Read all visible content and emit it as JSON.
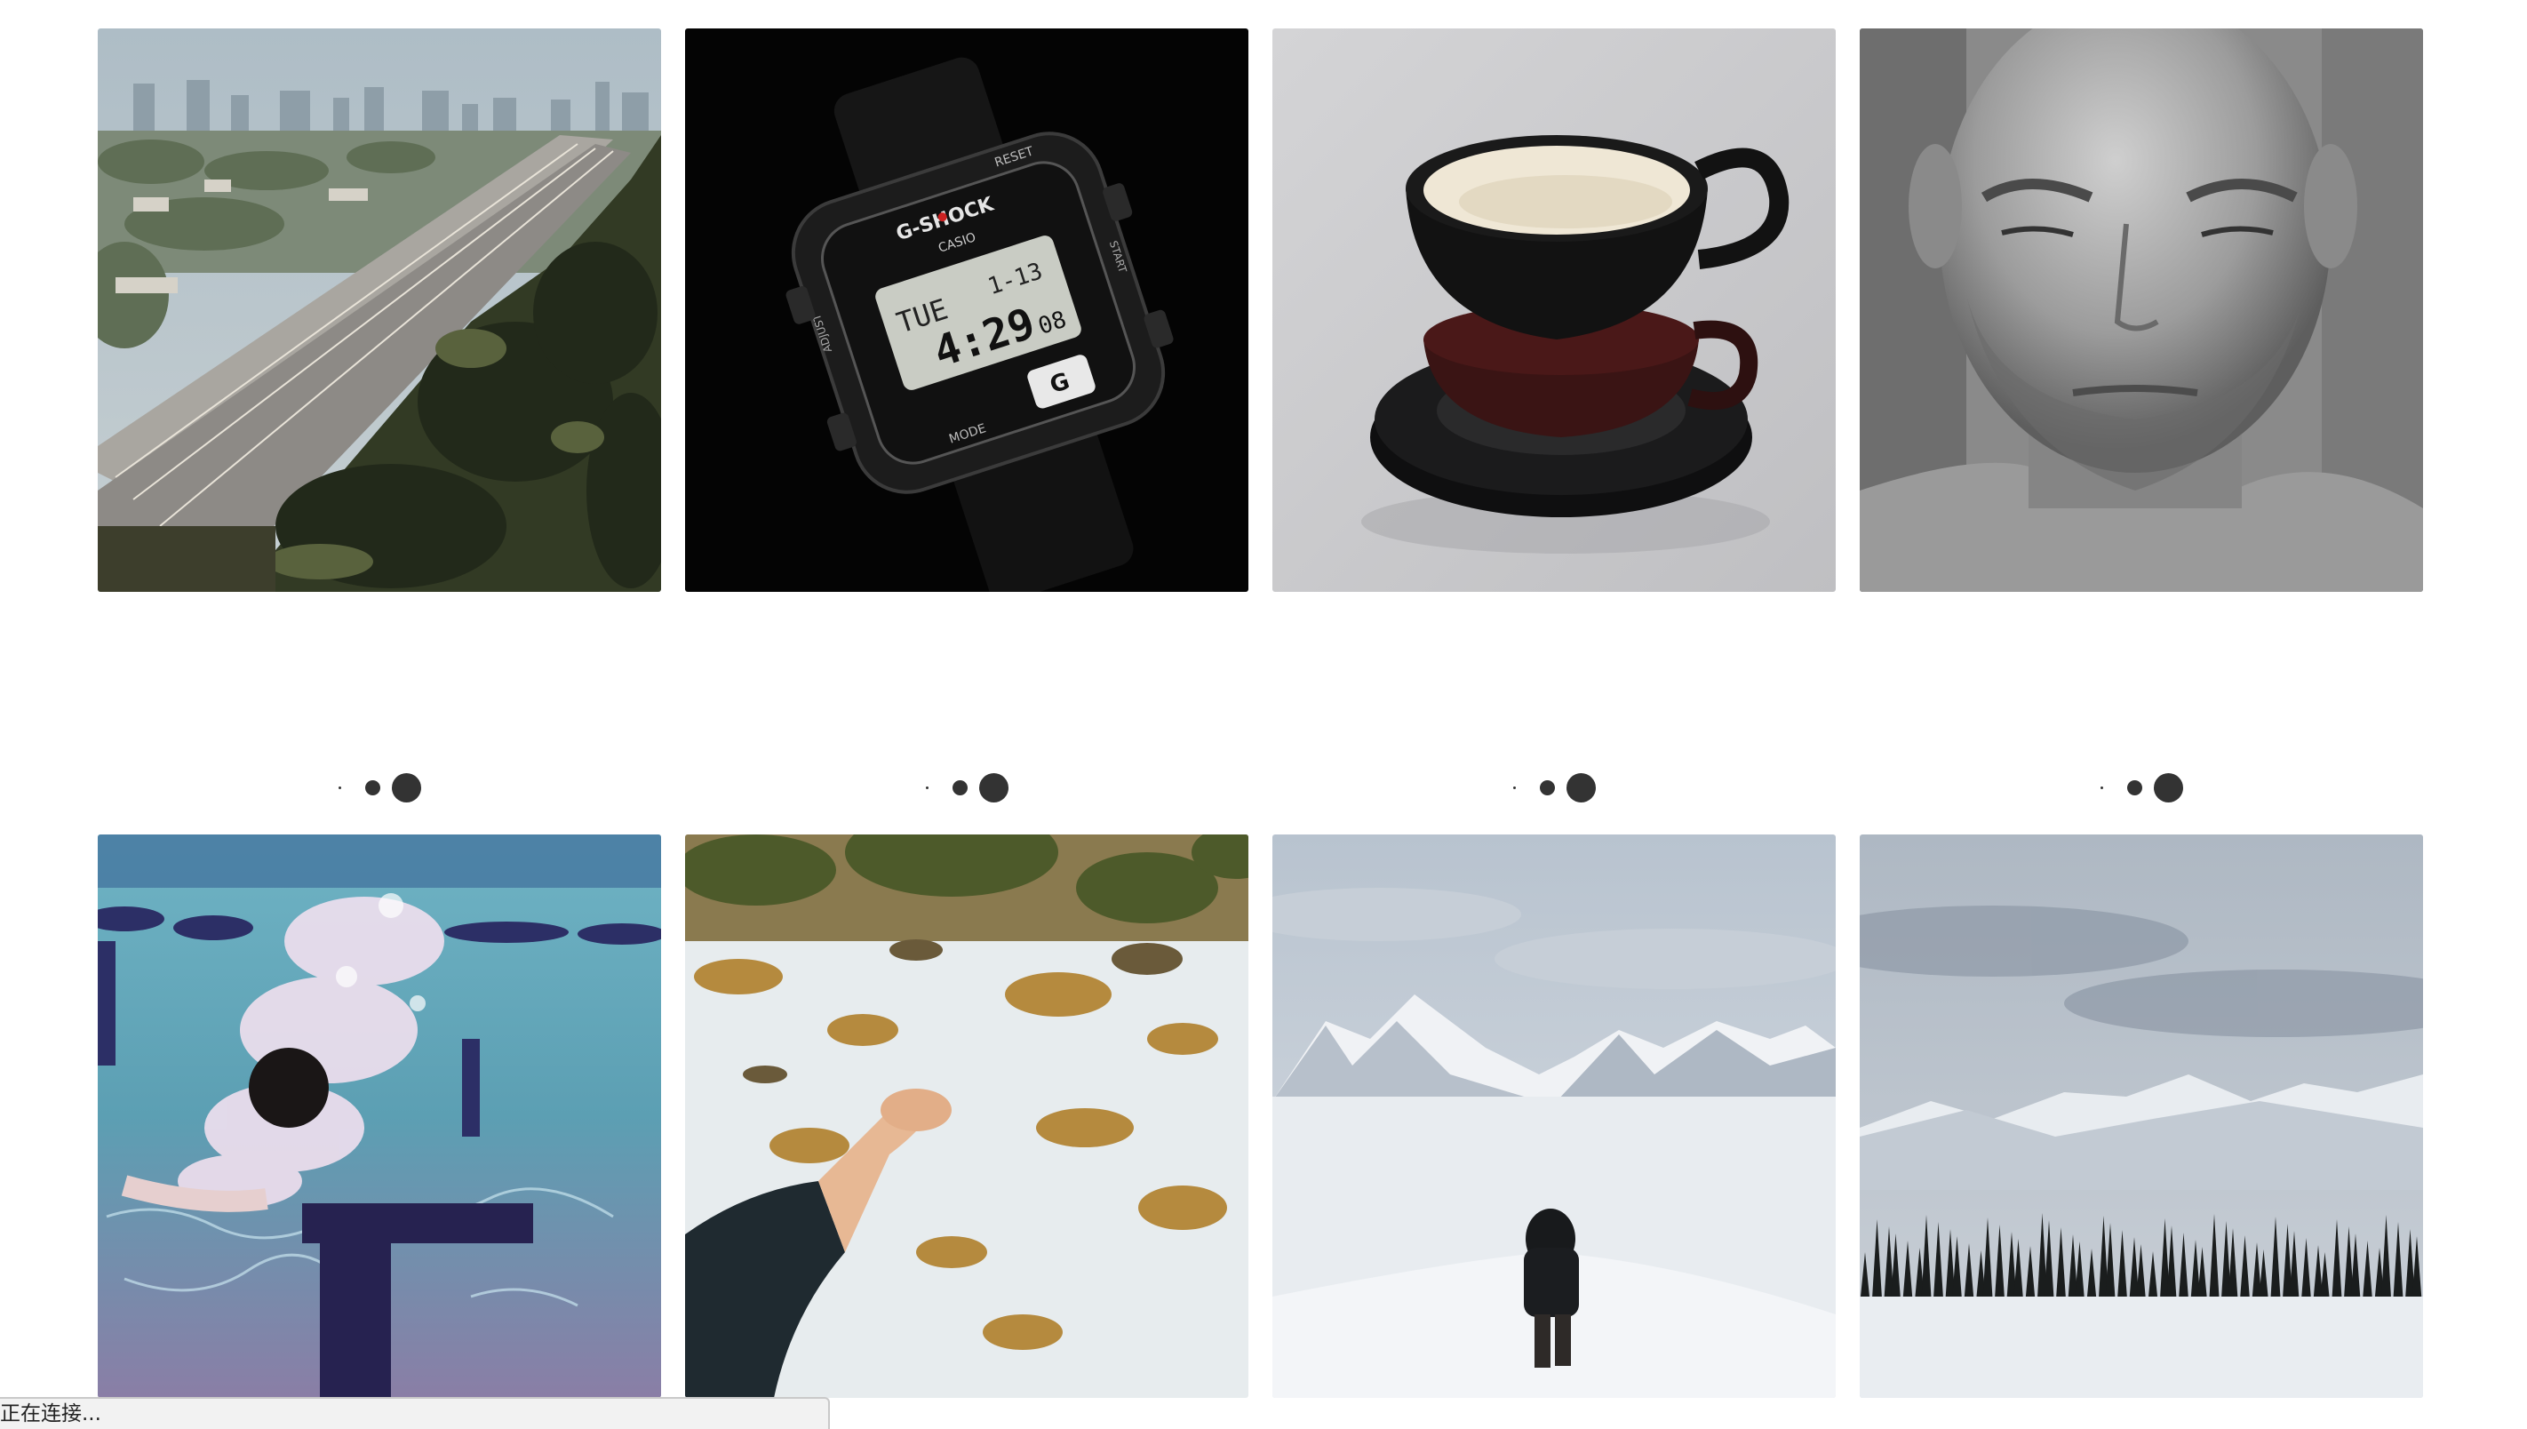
{
  "gallery": {
    "row1": [
      {
        "name": "photo-city-freeway",
        "alt": "city freeway"
      },
      {
        "name": "photo-gshock-watch",
        "alt": "watch"
      },
      {
        "name": "photo-coffee-cups",
        "alt": "cups"
      },
      {
        "name": "photo-man-portrait",
        "alt": "portrait"
      }
    ],
    "row2": [
      {
        "name": "photo-underwater-swimmer",
        "alt": "swimmer"
      },
      {
        "name": "photo-hand-snow",
        "alt": "hand over snow"
      },
      {
        "name": "photo-person-snowfield",
        "alt": "person in snow"
      },
      {
        "name": "photo-snowy-forest",
        "alt": "snowy forest"
      }
    ]
  },
  "watch": {
    "brand": "G-SHOCK",
    "maker": "CASIO",
    "day": "TUE",
    "date": "1-13",
    "time": "4:29",
    "seconds": "08",
    "bezel_left": "ADJUST",
    "bezel_right": "START",
    "bezel_top": "RESET",
    "bezel_bottom": "MODE"
  },
  "status": {
    "text": "正在连接..."
  }
}
